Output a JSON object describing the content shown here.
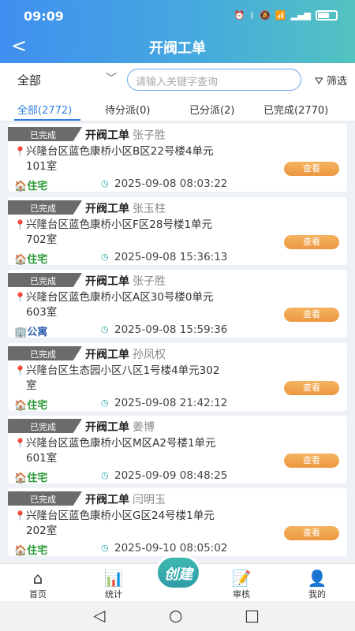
{
  "status": {
    "time": "09:09"
  },
  "header": {
    "back": "<",
    "title": "开阀工单"
  },
  "filter": {
    "selected": "全部",
    "search_placeholder": "请输入关键字查询",
    "filter_label": "筛选"
  },
  "tabs": [
    "全部(2772)",
    "待分派(0)",
    "已分派(2)",
    "已完成(2770)"
  ],
  "orders": [
    {
      "status": "已完成",
      "type": "开阀工单",
      "name": "张子胜",
      "addr1": "兴隆台区蓝色康桥小区B区22号楼4单元",
      "addr2": "101室",
      "ptype": "住宅",
      "date": "2025-09-08 08:03:22",
      "view": "查看"
    },
    {
      "status": "已完成",
      "type": "开阀工单",
      "name": "张玉柱",
      "addr1": "兴隆台区蓝色康桥小区F区28号楼1单元",
      "addr2": "702室",
      "ptype": "住宅",
      "date": "2025-09-08 15:36:13",
      "view": "查看"
    },
    {
      "status": "已完成",
      "type": "开阀工单",
      "name": "张子胜",
      "addr1": "兴隆台区蓝色康桥小区A区30号楼0单元",
      "addr2": "603室",
      "ptype": "公寓",
      "date": "2025-09-08 15:59:36",
      "view": "查看"
    },
    {
      "status": "已完成",
      "type": "开阀工单",
      "name": "孙凤权",
      "addr1": "兴隆台区生态园小区八区1号楼4单元302",
      "addr2": "室",
      "ptype": "住宅",
      "date": "2025-09-08 21:42:12",
      "view": "查看"
    },
    {
      "status": "已完成",
      "type": "开阀工单",
      "name": "姜博",
      "addr1": "兴隆台区蓝色康桥小区M区A2号楼1单元",
      "addr2": "601室",
      "ptype": "住宅",
      "date": "2025-09-09 08:48:25",
      "view": "查看"
    },
    {
      "status": "已完成",
      "type": "开阀工单",
      "name": "闫明玉",
      "addr1": "兴隆台区蓝色康桥小区G区24号楼1单元",
      "addr2": "202室",
      "ptype": "住宅",
      "date": "2025-09-10 08:05:02",
      "view": "查看"
    }
  ],
  "bottom_nav": {
    "home": "首页",
    "stats": "统计",
    "create": "创建",
    "review": "审核",
    "mine": "我的"
  }
}
